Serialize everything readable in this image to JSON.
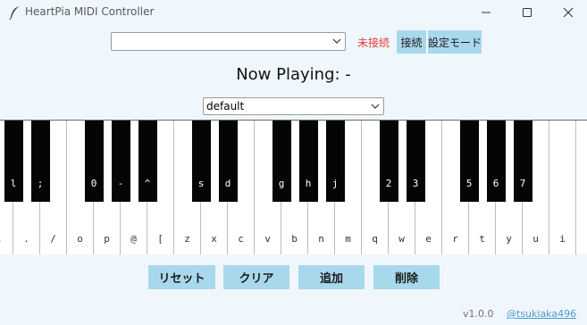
{
  "window": {
    "title": "HeartPia MIDI Controller",
    "icon": "quill-feather-icon",
    "controls": [
      "minimize",
      "maximize",
      "close"
    ]
  },
  "toolbar": {
    "device_select_value": "",
    "status": "未接続",
    "status_color": "#e03c3c",
    "connect_label": "接続",
    "settings_label": "設定モード"
  },
  "now_playing": {
    "text": "Now Playing: -"
  },
  "preset": {
    "value": "default"
  },
  "keyboard": {
    "white_keys": [
      ",",
      ".",
      "/",
      "o",
      "p",
      "@",
      "[",
      "z",
      "x",
      "c",
      "v",
      "b",
      "n",
      "m",
      "q",
      "w",
      "e",
      "r",
      "t",
      "y",
      "u",
      "i"
    ],
    "black_keys": [
      "l",
      ";",
      "0",
      "-",
      "^",
      "s",
      "d",
      "g",
      "h",
      "j",
      "2",
      "3",
      "5",
      "6",
      "7"
    ]
  },
  "actions": {
    "reset_label": "リセット",
    "clear_label": "クリア",
    "add_label": "追加",
    "delete_label": "削除"
  },
  "footer": {
    "version": "v1.0.0",
    "author": "@tsukiaka496"
  },
  "colors": {
    "accent_button": "#a8d8ec",
    "background": "#f0f7fc",
    "link": "#4a9ad0"
  }
}
